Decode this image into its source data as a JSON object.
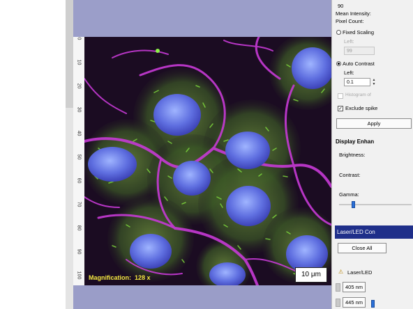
{
  "ruler": {
    "labels": [
      "0",
      "10",
      "20",
      "30",
      "40",
      "50",
      "60",
      "70",
      "80",
      "90",
      "100"
    ]
  },
  "image": {
    "magnification_label": "Magnification:",
    "magnification_value": "128 x",
    "scale_bar": "10 μm"
  },
  "panel": {
    "value_90": "90",
    "mean_intensity": "Mean Intensity:",
    "pixel_count": "Pixel Count:",
    "fixed_scaling": "Fixed Scaling",
    "left_label_1": "Left:",
    "left_value_1": "99",
    "auto_contrast": "Auto Contrast",
    "left_label_2": "Left:",
    "left_value_2": "0.1",
    "histogram_label": "Histogram of",
    "exclude_spikes": "Exclude spike",
    "apply_button": "Apply",
    "display_enhance": "Display Enhan",
    "brightness": "Brightness:",
    "contrast": "Contrast:",
    "gamma": "Gamma:",
    "laser_header": "Laser/LED Con",
    "close_all": "Close All",
    "laser_led": "Laser/LED",
    "wl_405": "405 nm",
    "wl_445": "445 nm"
  },
  "colors": {
    "laser_header_bg": "#1f2f8a",
    "magnification_text": "#f5e840",
    "slider_accent": "#2a6fd6"
  }
}
